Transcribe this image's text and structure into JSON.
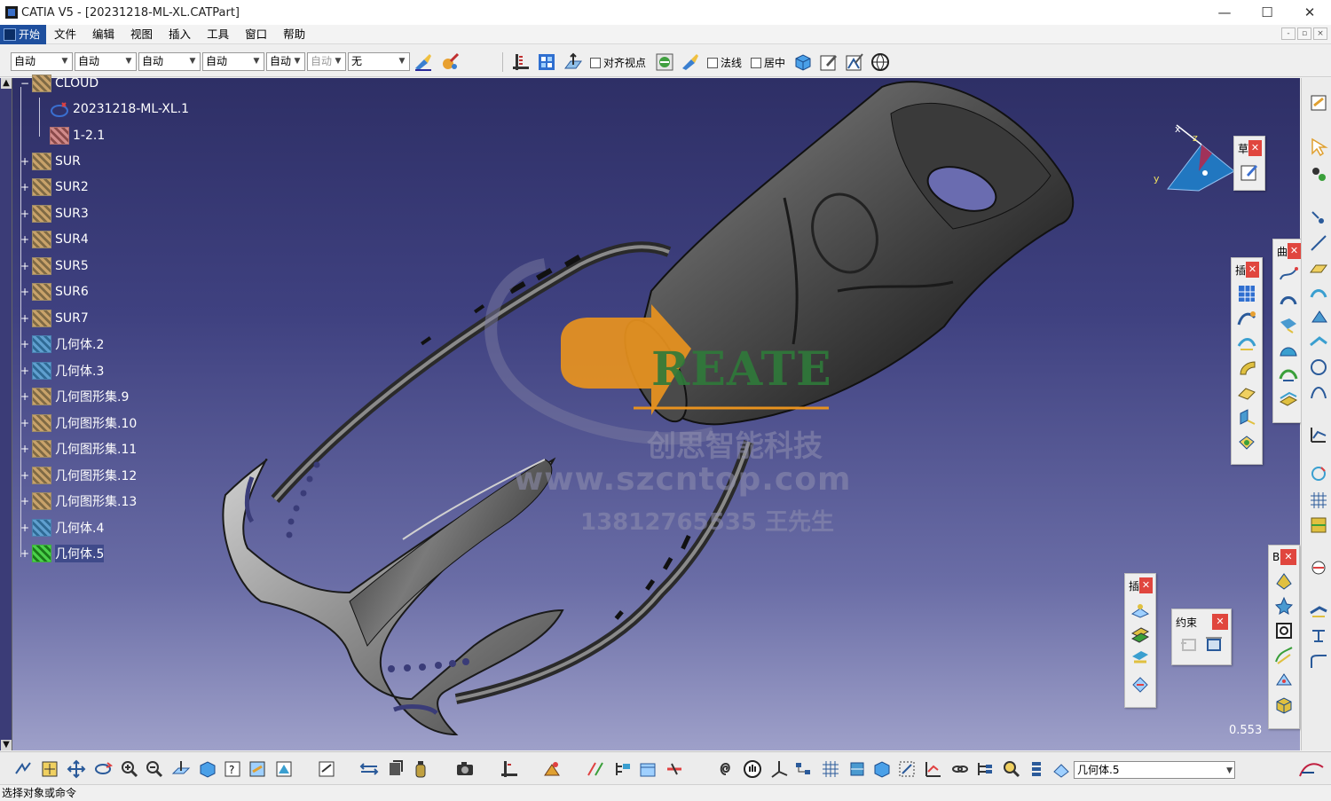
{
  "window": {
    "title": "CATIA V5 - [20231218-ML-XL.CATPart]",
    "minimize": "—",
    "maximize": "☐",
    "close": "✕"
  },
  "menubar": {
    "start": "开始",
    "items": [
      "文件",
      "编辑",
      "视图",
      "插入",
      "工具",
      "窗口",
      "帮助"
    ],
    "mdi": [
      "-",
      "▫",
      "×"
    ]
  },
  "toptoolbar": {
    "dropdowns": [
      {
        "value": "自动",
        "disabled": false
      },
      {
        "value": "自动",
        "disabled": false
      },
      {
        "value": "自动",
        "disabled": false
      },
      {
        "value": "自动",
        "disabled": false
      },
      {
        "value": "自动",
        "disabled": false
      },
      {
        "value": "自动",
        "disabled": true
      },
      {
        "value": "无",
        "disabled": false
      }
    ],
    "checkboxes": [
      "对齐视点",
      "法线",
      "居中"
    ]
  },
  "tree": {
    "root": "CLOUD",
    "children": [
      {
        "label": "20231218-ML-XL.1",
        "icon": "cloud-part-icon"
      },
      {
        "label": "1-2.1",
        "icon": "cloud-points-icon"
      }
    ],
    "items": [
      {
        "label": "SUR",
        "type": "geoset"
      },
      {
        "label": "SUR2",
        "type": "geoset"
      },
      {
        "label": "SUR3",
        "type": "geoset"
      },
      {
        "label": "SUR4",
        "type": "geoset"
      },
      {
        "label": "SUR5",
        "type": "geoset"
      },
      {
        "label": "SUR6",
        "type": "geoset"
      },
      {
        "label": "SUR7",
        "type": "geoset"
      },
      {
        "label": "几何体.2",
        "type": "body"
      },
      {
        "label": "几何体.3",
        "type": "body"
      },
      {
        "label": "几何图形集.9",
        "type": "geoset"
      },
      {
        "label": "几何图形集.10",
        "type": "geoset"
      },
      {
        "label": "几何图形集.11",
        "type": "geoset"
      },
      {
        "label": "几何图形集.12",
        "type": "geoset"
      },
      {
        "label": "几何图形集.13",
        "type": "geoset"
      },
      {
        "label": "几何体.4",
        "type": "body"
      },
      {
        "label": "几何体.5",
        "type": "active-body"
      }
    ]
  },
  "watermark": {
    "brand": "REATE",
    "company": "创思智能科技",
    "url": "www.szcntop.com",
    "phone": "13812765535 王先生"
  },
  "compass": {
    "x": "x",
    "y": "y",
    "z": "z"
  },
  "floating_toolbars": {
    "tb1_title": "草",
    "tb2_title": "插",
    "tb3_title": "曲",
    "tb4_title": "约束",
    "tb5_title": "B",
    "tb6_title": "插"
  },
  "viewport": {
    "zoom_readout": "0.553"
  },
  "bottombar": {
    "command_value": "几何体.5"
  },
  "statusbar": {
    "text": "选择对象或命令"
  },
  "colors": {
    "background_top": "#2e2f66",
    "background_bottom": "#9ea0c9",
    "watermark_orange": "#e8921e",
    "watermark_green": "#2f7a3a",
    "close_red": "#e0463e"
  }
}
